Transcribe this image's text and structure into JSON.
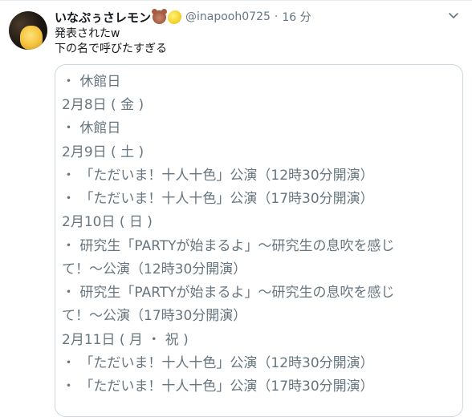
{
  "tweet": {
    "display_name": "いなぷぅさレモン",
    "emoji_icons": [
      "bear-face-icon",
      "lemon-icon"
    ],
    "handle": "@inapooh0725",
    "separator": "·",
    "time": "16 分",
    "text_line_1": "発表されたw",
    "text_line_2": "下の名で呼びたすぎる"
  },
  "card": {
    "lines": [
      "・ 休館日",
      "2月8日 ( 金 )",
      "・ 休館日",
      "2月9日 ( 土 )",
      "・ 「ただいま！十人十色」公演（12時30分開演）",
      "・ 「ただいま！十人十色」公演（17時30分開演）",
      "2月10日 ( 日 )",
      "・ 研究生「PARTYが始まるよ」〜研究生の息吹を感じ",
      "て！〜公演（12時30分開演）",
      "・ 研究生「PARTYが始まるよ」〜研究生の息吹を感じ",
      "て！〜公演（17時30分開演）",
      "2月11日 ( 月 ・ 祝 )",
      "・ 「ただいま！十人十色」公演（12時30分開演）",
      "・ 「ただいま！十人十色」公演（17時30分開演）"
    ]
  },
  "colors": {
    "name": "#14171a",
    "meta": "#657786",
    "card_text": "#66757f",
    "card_border": "#ccd6dd"
  }
}
